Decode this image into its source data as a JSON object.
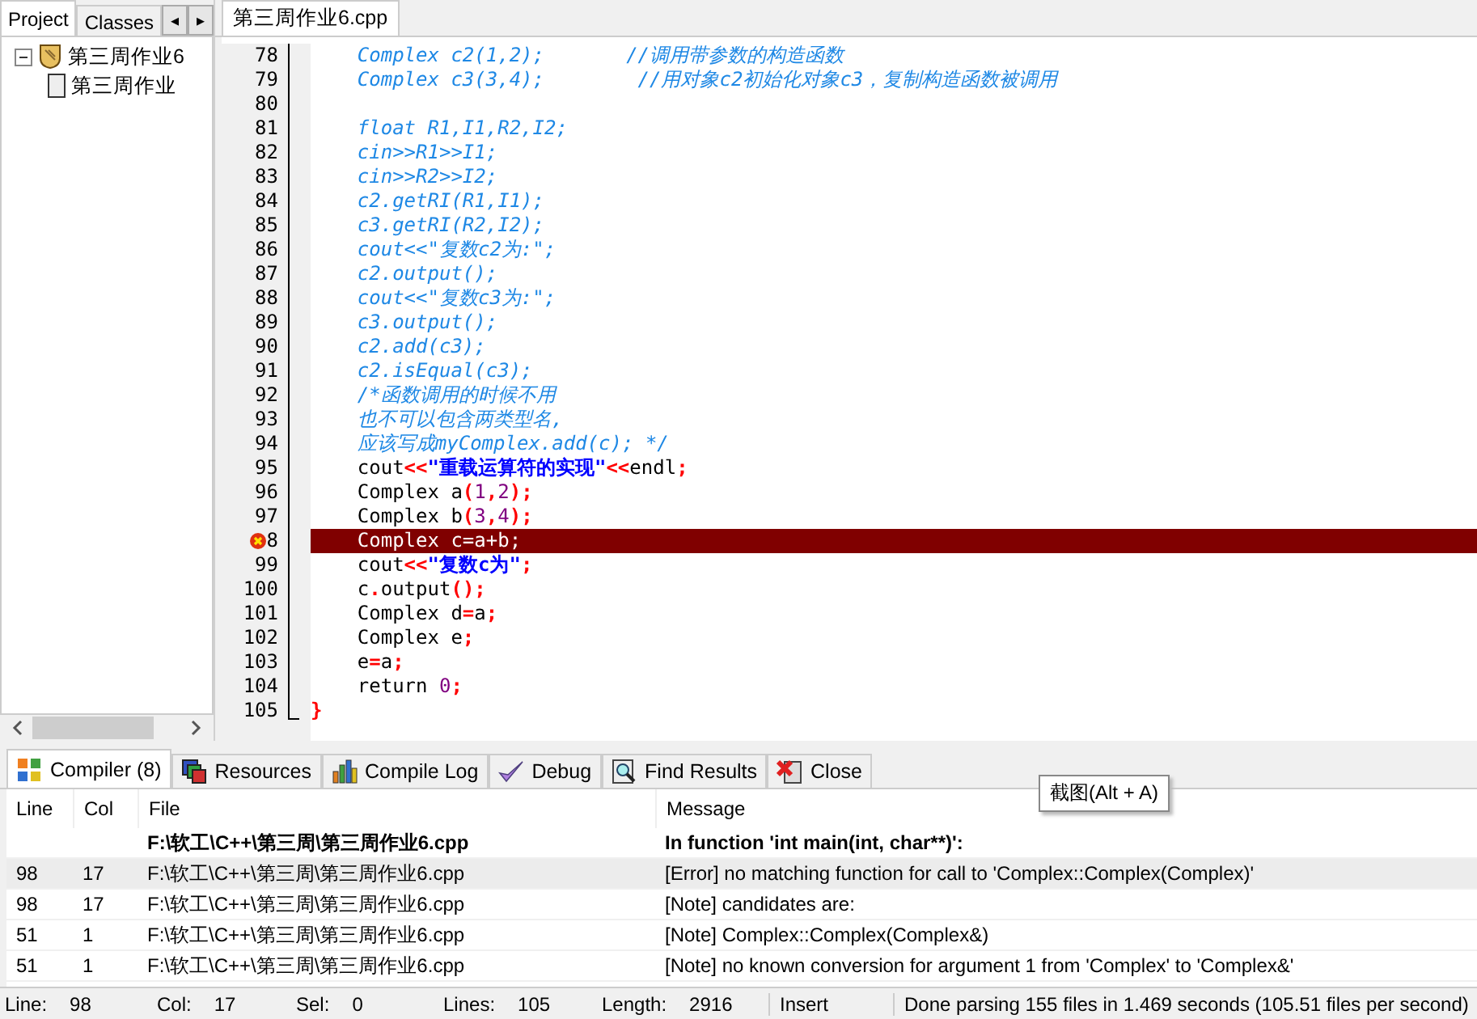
{
  "left_panel": {
    "tabs": [
      {
        "label": "Project",
        "selected": true
      },
      {
        "label": "Classes",
        "selected": false
      }
    ],
    "scroll_arrows": [
      "◂",
      "▸"
    ],
    "tree": [
      {
        "label": "第三周作业6",
        "expanded": true,
        "children": [
          {
            "label": "第三周作业"
          }
        ]
      }
    ]
  },
  "editor": {
    "tabs": [
      {
        "label": "第三周作业6.cpp",
        "selected": true
      }
    ],
    "lines": [
      {
        "number": "78",
        "error": false,
        "segments": [
          {
            "kind": "comment",
            "text": "    Complex c2(1,2);       //调用带参数的构造函数"
          }
        ]
      },
      {
        "number": "79",
        "error": false,
        "segments": [
          {
            "kind": "comment",
            "text": "    Complex c3(3,4);        //用对象c2初始化对象c3，复制构造函数被调用"
          }
        ]
      },
      {
        "number": "80",
        "error": false
      },
      {
        "number": "81",
        "error": false,
        "segments": [
          {
            "kind": "comment",
            "text": "    float R1,I1,R2,I2;"
          }
        ]
      },
      {
        "number": "82",
        "error": false,
        "segments": [
          {
            "kind": "comment",
            "text": "    cin>>R1>>I1;"
          }
        ]
      },
      {
        "number": "83",
        "error": false,
        "segments": [
          {
            "kind": "comment",
            "text": "    cin>>R2>>I2;"
          }
        ]
      },
      {
        "number": "84",
        "error": false,
        "segments": [
          {
            "kind": "comment",
            "text": "    c2.getRI(R1,I1);"
          }
        ]
      },
      {
        "number": "85",
        "error": false,
        "segments": [
          {
            "kind": "comment",
            "text": "    c3.getRI(R2,I2);"
          }
        ]
      },
      {
        "number": "86",
        "error": false,
        "segments": [
          {
            "kind": "comment",
            "text": "    cout<<\"复数c2为:\";"
          }
        ]
      },
      {
        "number": "87",
        "error": false,
        "segments": [
          {
            "kind": "comment",
            "text": "    c2.output();"
          }
        ]
      },
      {
        "number": "88",
        "error": false,
        "segments": [
          {
            "kind": "comment",
            "text": "    cout<<\"复数c3为:\";"
          }
        ]
      },
      {
        "number": "89",
        "error": false,
        "segments": [
          {
            "kind": "comment",
            "text": "    c3.output();"
          }
        ]
      },
      {
        "number": "90",
        "error": false,
        "segments": [
          {
            "kind": "comment",
            "text": "    c2.add(c3);"
          }
        ]
      },
      {
        "number": "91",
        "error": false,
        "segments": [
          {
            "kind": "comment",
            "text": "    c2.isEqual(c3);"
          }
        ]
      },
      {
        "number": "92",
        "error": false,
        "segments": [
          {
            "kind": "comment",
            "text": "    /*函数调用的时候不用"
          }
        ]
      },
      {
        "number": "93",
        "error": false,
        "segments": [
          {
            "kind": "comment",
            "text": "    也不可以包含两类型名,"
          }
        ]
      },
      {
        "number": "94",
        "error": false,
        "segments": [
          {
            "kind": "comment",
            "text": "    应该写成myComplex.add(c); */"
          }
        ]
      },
      {
        "number": "95",
        "error": false,
        "segments": [
          {
            "kind": "plain",
            "text": "    cout"
          },
          {
            "kind": "symbol",
            "text": "<<"
          },
          {
            "kind": "string",
            "text": "\"重载运算符的实现\""
          },
          {
            "kind": "symbol",
            "text": "<<"
          },
          {
            "kind": "plain",
            "text": "endl"
          },
          {
            "kind": "symbol",
            "text": ";"
          }
        ]
      },
      {
        "number": "96",
        "error": false,
        "segments": [
          {
            "kind": "plain",
            "text": "    Complex a"
          },
          {
            "kind": "symbol",
            "text": "("
          },
          {
            "kind": "number",
            "text": "1"
          },
          {
            "kind": "symbol",
            "text": ","
          },
          {
            "kind": "number",
            "text": "2"
          },
          {
            "kind": "symbol",
            "text": ");"
          }
        ]
      },
      {
        "number": "97",
        "error": false,
        "segments": [
          {
            "kind": "plain",
            "text": "    Complex b"
          },
          {
            "kind": "symbol",
            "text": "("
          },
          {
            "kind": "number",
            "text": "3"
          },
          {
            "kind": "symbol",
            "text": ","
          },
          {
            "kind": "number",
            "text": "4"
          },
          {
            "kind": "symbol",
            "text": ");"
          }
        ]
      },
      {
        "number": "8",
        "error": true,
        "segments": [
          {
            "kind": "plain",
            "text": "    Complex c=a+b;"
          }
        ]
      },
      {
        "number": "99",
        "error": false,
        "segments": [
          {
            "kind": "plain",
            "text": "    cout"
          },
          {
            "kind": "symbol",
            "text": "<<"
          },
          {
            "kind": "string",
            "text": "\"复数c为\""
          },
          {
            "kind": "symbol",
            "text": ";"
          }
        ]
      },
      {
        "number": "100",
        "error": false,
        "segments": [
          {
            "kind": "plain",
            "text": "    c"
          },
          {
            "kind": "symbol",
            "text": "."
          },
          {
            "kind": "plain",
            "text": "output"
          },
          {
            "kind": "symbol",
            "text": "();"
          }
        ]
      },
      {
        "number": "101",
        "error": false,
        "segments": [
          {
            "kind": "plain",
            "text": "    Complex d"
          },
          {
            "kind": "symbol",
            "text": "="
          },
          {
            "kind": "plain",
            "text": "a"
          },
          {
            "kind": "symbol",
            "text": ";"
          }
        ]
      },
      {
        "number": "102",
        "error": false,
        "segments": [
          {
            "kind": "plain",
            "text": "    Complex e"
          },
          {
            "kind": "symbol",
            "text": ";"
          }
        ]
      },
      {
        "number": "103",
        "error": false,
        "segments": [
          {
            "kind": "plain",
            "text": "    e"
          },
          {
            "kind": "symbol",
            "text": "="
          },
          {
            "kind": "plain",
            "text": "a"
          },
          {
            "kind": "symbol",
            "text": ";"
          }
        ]
      },
      {
        "number": "104",
        "error": false,
        "segments": [
          {
            "kind": "plain",
            "text": "    return "
          },
          {
            "kind": "number",
            "text": "0"
          },
          {
            "kind": "symbol",
            "text": ";"
          }
        ]
      },
      {
        "number": "105",
        "error": false,
        "segments": [
          {
            "kind": "symbol",
            "text": "}"
          }
        ]
      }
    ]
  },
  "bottom_tabs": [
    {
      "label": "Compiler (8)",
      "selected": true
    },
    {
      "label": "Resources",
      "selected": false
    },
    {
      "label": "Compile Log",
      "selected": false
    },
    {
      "label": "Debug",
      "selected": false
    },
    {
      "label": "Find Results",
      "selected": false
    },
    {
      "label": "Close",
      "selected": false
    }
  ],
  "tooltip": "截图(Alt + A)",
  "table": {
    "columns": [
      "Line",
      "Col",
      "File",
      "Message"
    ],
    "rows": [
      {
        "kind": "group",
        "selected": false,
        "file": "F:\\软工\\C++\\第三周\\第三周作业6.cpp",
        "message": "In function 'int main(int, char**)':"
      },
      {
        "kind": "item",
        "selected": true,
        "line": "98",
        "col": "17",
        "file": "F:\\软工\\C++\\第三周\\第三周作业6.cpp",
        "message": "[Error] no matching function for call to 'Complex::Complex(Complex)'"
      },
      {
        "kind": "item",
        "selected": false,
        "line": "98",
        "col": "17",
        "file": "F:\\软工\\C++\\第三周\\第三周作业6.cpp",
        "message": "[Note] candidates are:"
      },
      {
        "kind": "item",
        "selected": false,
        "line": "51",
        "col": "1",
        "file": "F:\\软工\\C++\\第三周\\第三周作业6.cpp",
        "message": "[Note] Complex::Complex(Complex&)"
      },
      {
        "kind": "item",
        "selected": false,
        "line": "51",
        "col": "1",
        "file": "F:\\软工\\C++\\第三周\\第三周作业6.cpp",
        "message": "[Note] no known conversion for argument 1 from 'Complex' to 'Complex&'"
      }
    ]
  },
  "status_bar": {
    "fields": [
      {
        "label": "Line:",
        "value": "98"
      },
      {
        "label": "Col:",
        "value": "17"
      },
      {
        "label": "Sel:",
        "value": "0"
      },
      {
        "label": "Lines:",
        "value": "105"
      },
      {
        "label": "Length:",
        "value": "2916"
      }
    ],
    "mode": "Insert",
    "message": "Done parsing 155 files in 1.469 seconds (105.51 files per second)"
  }
}
